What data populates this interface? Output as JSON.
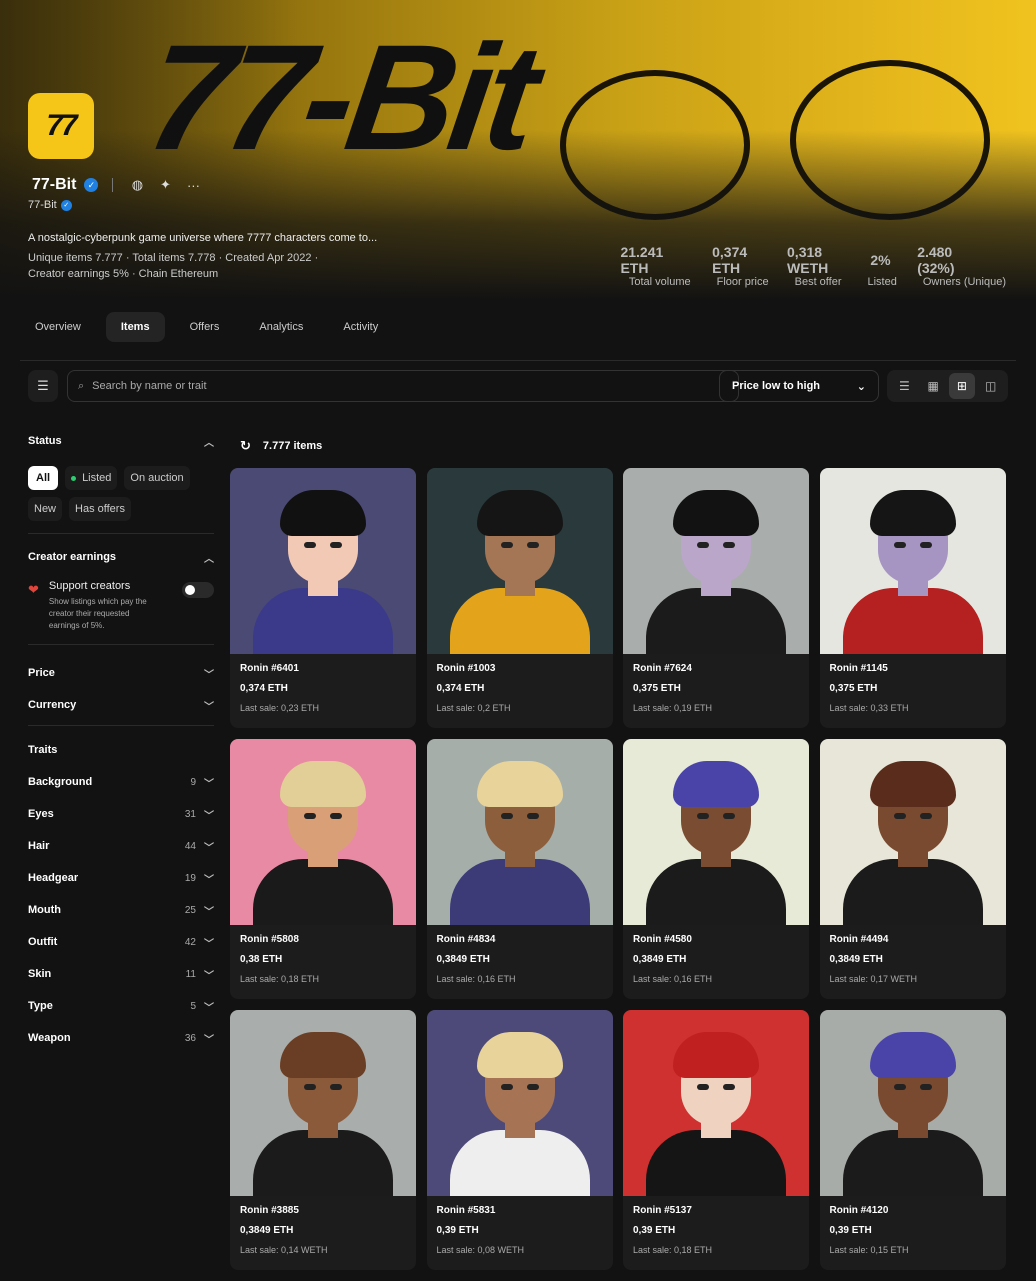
{
  "collection": {
    "banner_text": "77-Bit",
    "logo_text": "77",
    "name": "77-Bit",
    "creator": "77-Bit",
    "description": "A nostalgic-cyberpunk game universe where 7777 characters come to...",
    "meta_line1": "Unique items 7.777 · Total items 7.778 · Created Apr 2022 ·",
    "meta_line2": "Creator earnings 5% · Chain Ethereum"
  },
  "stats": [
    {
      "value": "21.241 ETH",
      "label": "Total volume"
    },
    {
      "value": "0,374 ETH",
      "label": "Floor price"
    },
    {
      "value": "0,318 WETH",
      "label": "Best offer"
    },
    {
      "value": "2%",
      "label": "Listed"
    },
    {
      "value": "2.480 (32%)",
      "label": "Owners (Unique)"
    }
  ],
  "tabs": [
    "Overview",
    "Items",
    "Offers",
    "Analytics",
    "Activity"
  ],
  "active_tab": "Items",
  "toolbar": {
    "search_placeholder": "Search by name or trait",
    "sort_label": "Price low to high"
  },
  "sidebar": {
    "status_title": "Status",
    "status_pills": [
      "All",
      "Listed",
      "On auction",
      "New",
      "Has offers"
    ],
    "creator_earnings_title": "Creator earnings",
    "support_title": "Support creators",
    "support_desc": "Show listings which pay the creator their requested earnings of 5%.",
    "price_title": "Price",
    "currency_title": "Currency",
    "traits_title": "Traits",
    "traits": [
      {
        "name": "Background",
        "count": "9"
      },
      {
        "name": "Eyes",
        "count": "31"
      },
      {
        "name": "Hair",
        "count": "44"
      },
      {
        "name": "Headgear",
        "count": "19"
      },
      {
        "name": "Mouth",
        "count": "25"
      },
      {
        "name": "Outfit",
        "count": "42"
      },
      {
        "name": "Skin",
        "count": "11"
      },
      {
        "name": "Type",
        "count": "5"
      },
      {
        "name": "Weapon",
        "count": "36"
      }
    ]
  },
  "items_count": "7.777 items",
  "items": [
    {
      "name": "Ronin #6401",
      "price": "0,374 ETH",
      "last": "Last sale: 0,23 ETH",
      "bg": "#4b4a74",
      "skin": "#f2c9b5",
      "hair": "#111111",
      "shirt": "#3b3a8a"
    },
    {
      "name": "Ronin #1003",
      "price": "0,374 ETH",
      "last": "Last sale: 0,2 ETH",
      "bg": "#2a3a3c",
      "skin": "#a47656",
      "hair": "#151515",
      "shirt": "#e3a41b"
    },
    {
      "name": "Ronin #7624",
      "price": "0,375 ETH",
      "last": "Last sale: 0,19 ETH",
      "bg": "#a9adab",
      "skin": "#b9a6c8",
      "hair": "#121212",
      "shirt": "#1b1b1b"
    },
    {
      "name": "Ronin #1145",
      "price": "0,375 ETH",
      "last": "Last sale: 0,33 ETH",
      "bg": "#e6e6e0",
      "skin": "#a695c2",
      "hair": "#151515",
      "shirt": "#b52020"
    },
    {
      "name": "Ronin #5808",
      "price": "0,38 ETH",
      "last": "Last sale: 0,18 ETH",
      "bg": "#e88aa4",
      "skin": "#d9a078",
      "hair": "#e2cf98",
      "shirt": "#1a1a1a"
    },
    {
      "name": "Ronin #4834",
      "price": "0,3849 ETH",
      "last": "Last sale: 0,16 ETH",
      "bg": "#a6aeaa",
      "skin": "#8c5e3c",
      "hair": "#e8d49a",
      "shirt": "#3d3a78"
    },
    {
      "name": "Ronin #4580",
      "price": "0,3849 ETH",
      "last": "Last sale: 0,16 ETH",
      "bg": "#e8ead8",
      "skin": "#7a4c32",
      "hair": "#4a44a8",
      "shirt": "#1b1b1b"
    },
    {
      "name": "Ronin #4494",
      "price": "0,3849 ETH",
      "last": "Last sale: 0,17 WETH",
      "bg": "#e8e6d8",
      "skin": "#7a4a30",
      "hair": "#5a2c1c",
      "shirt": "#1b1b1b"
    },
    {
      "name": "Ronin #3885",
      "price": "0,3849 ETH",
      "last": "Last sale: 0,14 WETH",
      "bg": "#a9adab",
      "skin": "#8a5a3a",
      "hair": "#6a3e24",
      "shirt": "#1b1b1b"
    },
    {
      "name": "Ronin #5831",
      "price": "0,39 ETH",
      "last": "Last sale: 0,08 WETH",
      "bg": "#4d4a7a",
      "skin": "#a67454",
      "hair": "#e8d49a",
      "shirt": "#eeeeee"
    },
    {
      "name": "Ronin #5137",
      "price": "0,39 ETH",
      "last": "Last sale: 0,18 ETH",
      "bg": "#cf3030",
      "skin": "#f0d2c0",
      "hair": "#c02020",
      "shirt": "#151515"
    },
    {
      "name": "Ronin #4120",
      "price": "0,39 ETH",
      "last": "Last sale: 0,15 ETH",
      "bg": "#a8aca9",
      "skin": "#7a4a30",
      "hair": "#4a44a8",
      "shirt": "#1b1b1b"
    }
  ]
}
